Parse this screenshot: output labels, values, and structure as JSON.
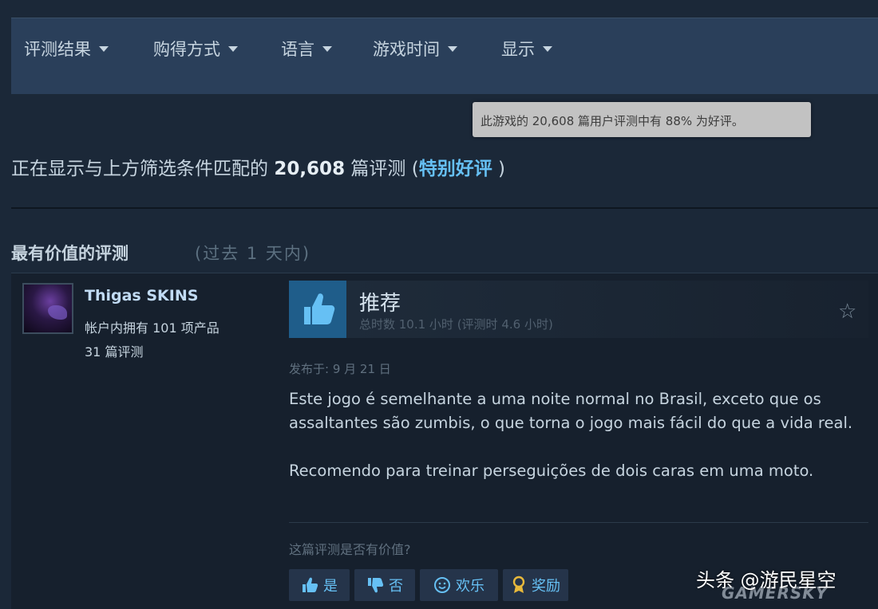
{
  "filters": [
    {
      "label": "评测结果"
    },
    {
      "label": "购得方式"
    },
    {
      "label": "语言"
    },
    {
      "label": "游戏时间"
    },
    {
      "label": "显示"
    }
  ],
  "tooltip": "此游戏的 20,608 篇用户评测中有 88% 为好评。",
  "summary": {
    "prefix": "正在显示与上方筛选条件匹配的",
    "count": "20,608",
    "suffix": "篇评测 (",
    "rating": "特别好评",
    "close": ")"
  },
  "section": {
    "title": "最有价值的评测",
    "subtitle": "(过去 1 天内)"
  },
  "review": {
    "username": "Thigas SKINS",
    "products": "帐户内拥有 101 项产品",
    "reviews": "31 篇评测",
    "recommendation": "推荐",
    "hours": "总时数 10.1 小时 (评测时 4.6 小时)",
    "posted": "发布于: 9 月 21 日",
    "paragraphs": [
      "Este jogo é semelhante a uma noite normal no Brasil, exceto que os assaltantes são zumbis, o que torna o jogo mais fácil do que a vida real.",
      "Recomendo para treinar perseguições de dois caras em uma moto."
    ],
    "helpful_question": "这篇评测是否有价值?"
  },
  "buttons": {
    "yes": "是",
    "no": "否",
    "funny": "欢乐",
    "award": "奖励"
  },
  "watermark": {
    "main": "头条 @游民星空",
    "sub": "GAMERSKY"
  },
  "colors": {
    "background": "#1b2838",
    "filterbar": "#2a3f5a",
    "accent": "#66c0f4",
    "thumb_box": "#1f5d8a"
  },
  "icons": [
    "chevron-down-icon",
    "thumbs-up-icon",
    "star-icon",
    "thumbs-down-icon",
    "smiley-icon",
    "award-icon"
  ]
}
